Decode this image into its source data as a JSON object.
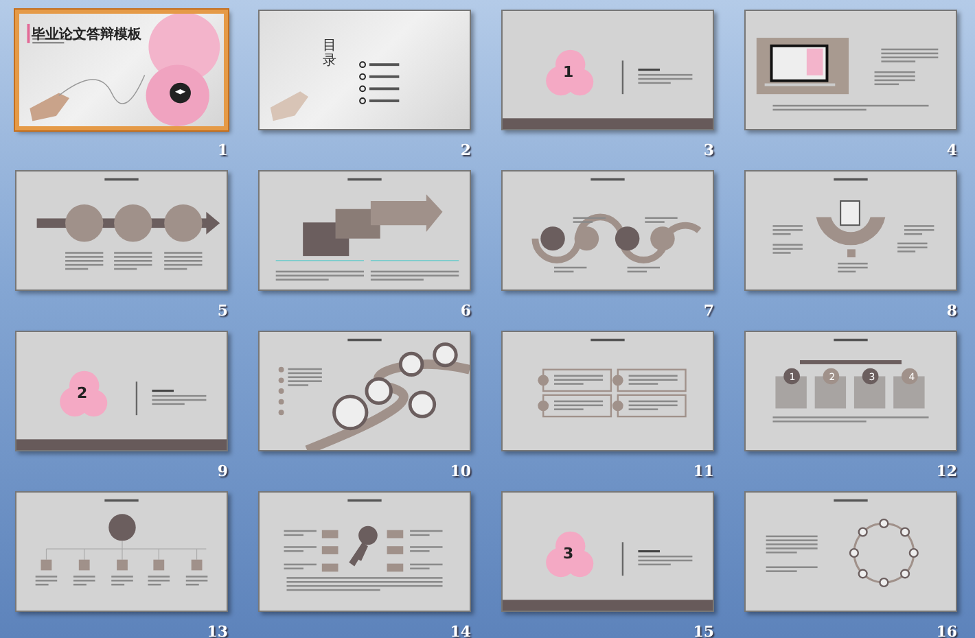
{
  "slides": [
    {
      "number": "1",
      "kind": "title",
      "selected": true,
      "title": "毕业论文答辩模板"
    },
    {
      "number": "2",
      "kind": "toc",
      "selected": false,
      "title": "目录"
    },
    {
      "number": "3",
      "kind": "section",
      "selected": false,
      "badge": "1"
    },
    {
      "number": "4",
      "kind": "laptop",
      "selected": false
    },
    {
      "number": "5",
      "kind": "timeline",
      "selected": false
    },
    {
      "number": "6",
      "kind": "steps",
      "selected": false
    },
    {
      "number": "7",
      "kind": "wave",
      "selected": false
    },
    {
      "number": "8",
      "kind": "fan",
      "selected": false
    },
    {
      "number": "9",
      "kind": "section",
      "selected": false,
      "badge": "2"
    },
    {
      "number": "10",
      "kind": "road",
      "selected": false
    },
    {
      "number": "11",
      "kind": "list4",
      "selected": false
    },
    {
      "number": "12",
      "kind": "cards",
      "selected": false,
      "cards": [
        "1",
        "2",
        "3",
        "4"
      ]
    },
    {
      "number": "13",
      "kind": "tree",
      "selected": false
    },
    {
      "number": "14",
      "kind": "key",
      "selected": false
    },
    {
      "number": "15",
      "kind": "section",
      "selected": false,
      "badge": "3"
    },
    {
      "number": "16",
      "kind": "ring",
      "selected": false
    }
  ]
}
